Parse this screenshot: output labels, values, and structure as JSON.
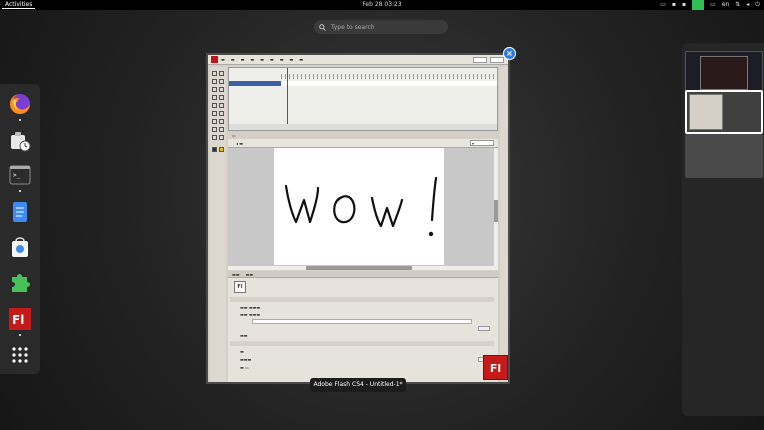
{
  "topbar": {
    "activities": "Activities",
    "clock": "Feb 28  03:23",
    "lang": "en",
    "accent": "#2fbf55"
  },
  "search": {
    "placeholder": "Type to search"
  },
  "dock": {
    "apps": [
      {
        "name": "Firefox",
        "icon": "firefox-icon",
        "running": true
      },
      {
        "name": "Software Updater",
        "icon": "software-update-icon",
        "running": false
      },
      {
        "name": "Terminal",
        "icon": "terminal-icon",
        "running": true
      },
      {
        "name": "Text Editor",
        "icon": "text-editor-icon",
        "running": false
      },
      {
        "name": "Software",
        "icon": "software-store-icon",
        "running": false
      },
      {
        "name": "Extensions",
        "icon": "puzzle-icon",
        "running": false
      },
      {
        "name": "Adobe Flash",
        "icon": "flash-icon",
        "running": true
      },
      {
        "name": "Show Applications",
        "icon": "app-grid-icon",
        "running": false
      }
    ]
  },
  "window": {
    "title": "Adobe Flash CS4 - Untitled-1*",
    "stage_text": "WOW!",
    "badge": "Fl",
    "props_icon": "Fl",
    "close_glyph": "×",
    "brand_color": "#c41a1a"
  }
}
